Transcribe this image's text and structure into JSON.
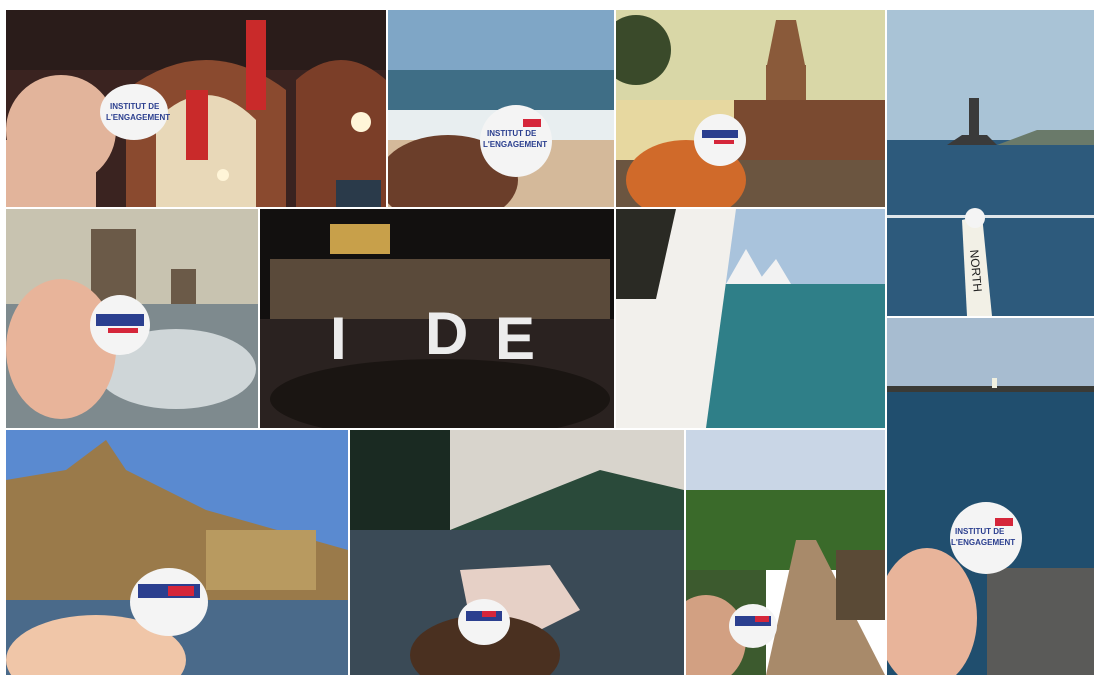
{
  "collage": {
    "badge_lines": [
      "INSTITUT DE",
      "L'ENGAGEMENT"
    ],
    "light_letters": [
      "I",
      "D",
      "E"
    ],
    "flag_text": "NORTH",
    "colors": {
      "badge_blue": "#2b3f8f",
      "badge_red": "#d5263a",
      "badge_white": "#f4f4f4",
      "skin": "#e9b59a"
    },
    "photos": [
      {
        "name": "copenhagen-station"
      },
      {
        "name": "beach-waves"
      },
      {
        "name": "town-hall-clocktower"
      },
      {
        "name": "lighthouse-sea"
      },
      {
        "name": "la-rochelle-towers"
      },
      {
        "name": "lyon-night-light-painting"
      },
      {
        "name": "sydney-opera-house"
      },
      {
        "name": "pier-lighthouse-sea"
      },
      {
        "name": "mont-saint-michel"
      },
      {
        "name": "lake-mountains"
      },
      {
        "name": "tropical-village-road"
      }
    ]
  }
}
